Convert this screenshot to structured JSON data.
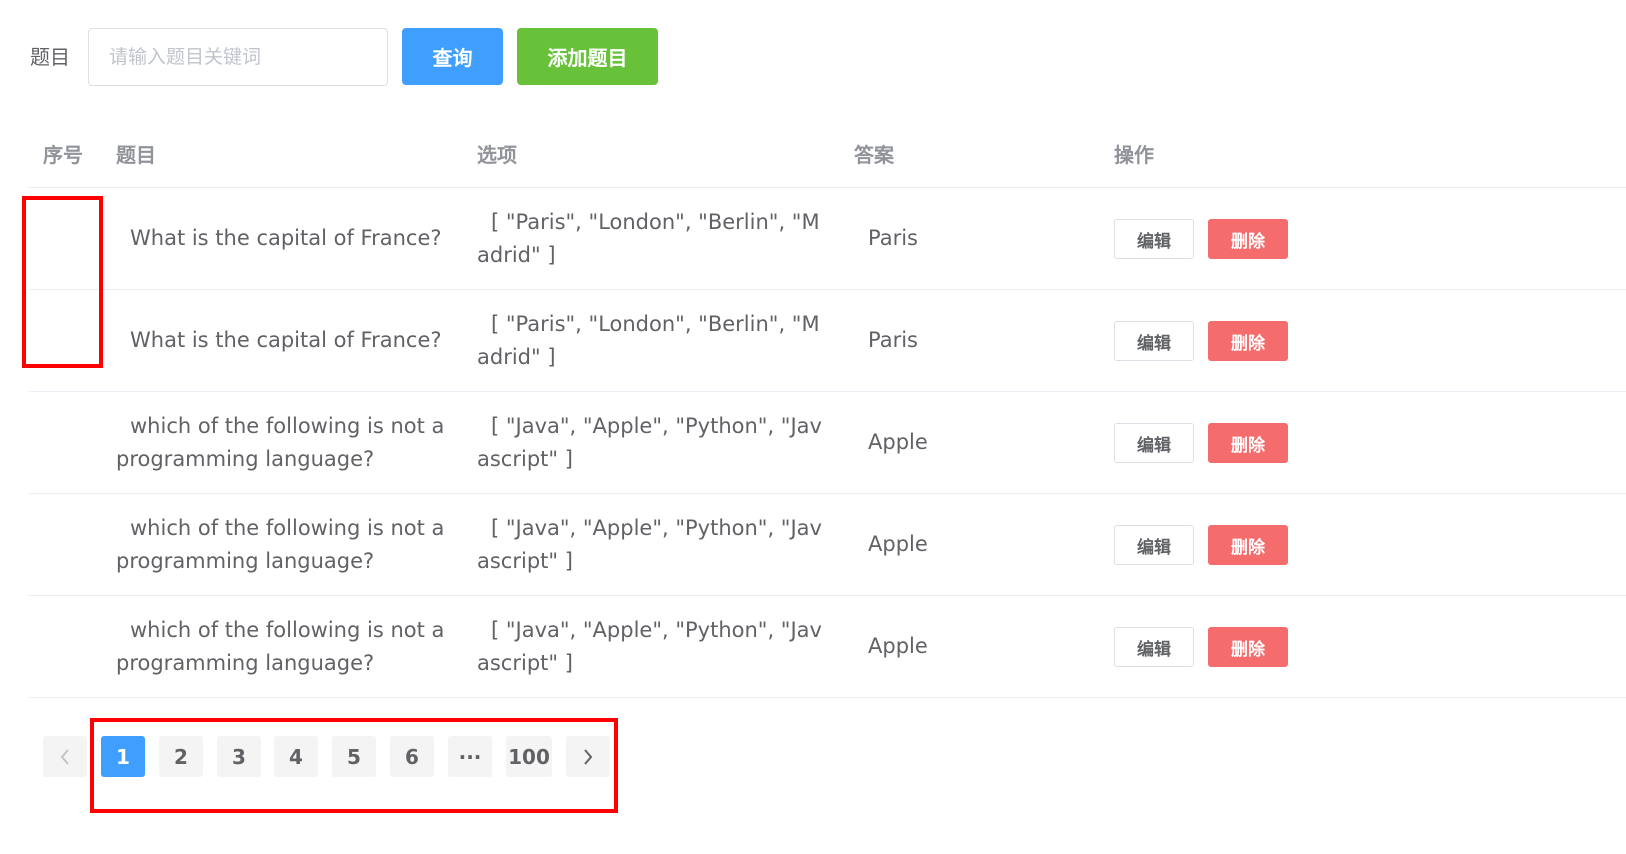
{
  "search": {
    "label": "题目",
    "placeholder": "请输入题目关键词",
    "query_label": "查询",
    "add_label": "添加题目"
  },
  "table": {
    "headers": [
      "序号",
      "题目",
      "选项",
      "答案",
      "操作"
    ],
    "rows": [
      {
        "id": "",
        "question": "What is the capital of France?",
        "options": "[ \"Paris\", \"London\", \"Berlin\", \"Madrid\" ]",
        "answer": "Paris"
      },
      {
        "id": "",
        "question": "What is the capital of France?",
        "options": "[ \"Paris\", \"London\", \"Berlin\", \"Madrid\" ]",
        "answer": "Paris"
      },
      {
        "id": "",
        "question": "which of the following is not a programming language?",
        "options": "[ \"Java\", \"Apple\", \"Python\", \"Javascript\" ]",
        "answer": "Apple"
      },
      {
        "id": "",
        "question": "which of the following is not a programming language?",
        "options": "[ \"Java\", \"Apple\", \"Python\", \"Javascript\" ]",
        "answer": "Apple"
      },
      {
        "id": "",
        "question": "which of the following is not a programming language?",
        "options": "[ \"Java\", \"Apple\", \"Python\", \"Javascript\" ]",
        "answer": "Apple"
      }
    ],
    "edit_label": "编辑",
    "delete_label": "删除"
  },
  "pager": {
    "prev_icon": "chevron-left-icon",
    "next_icon": "chevron-right-icon",
    "pages": [
      "1",
      "2",
      "3",
      "4",
      "5",
      "6",
      "···",
      "100"
    ],
    "current": "1"
  },
  "colors": {
    "primary": "#409eff",
    "success": "#67c23a",
    "danger": "#f56c6c",
    "highlight": "#ff0000"
  }
}
